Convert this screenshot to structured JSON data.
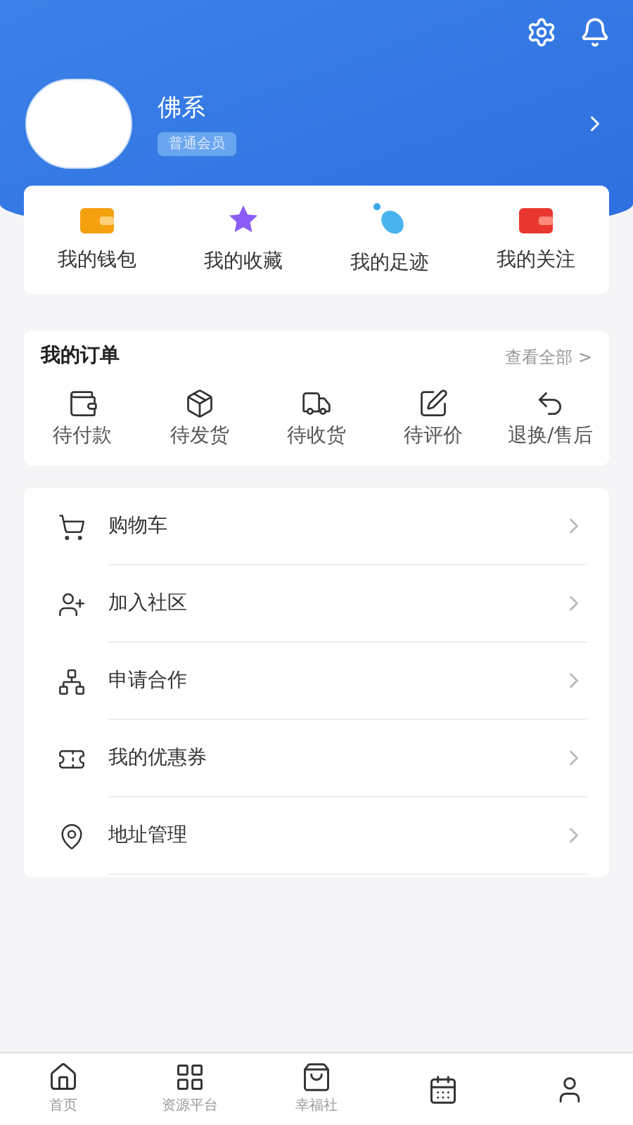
{
  "profile": {
    "name": "佛系",
    "badge": "普通会员"
  },
  "shortcuts": [
    {
      "kind": "wallet",
      "label": "我的钱包"
    },
    {
      "kind": "star",
      "label": "我的收藏"
    },
    {
      "kind": "foot",
      "label": "我的足迹"
    },
    {
      "kind": "follow",
      "label": "我的关注"
    }
  ],
  "orders": {
    "title": "我的订单",
    "view_all": "查看全部 >",
    "items": [
      {
        "kind": "pay",
        "label": "待付款"
      },
      {
        "kind": "ship",
        "label": "待发货"
      },
      {
        "kind": "receive",
        "label": "待收货"
      },
      {
        "kind": "review",
        "label": "待评价"
      },
      {
        "kind": "refund",
        "label": "退换/售后"
      }
    ]
  },
  "menu": [
    {
      "kind": "cart",
      "label": "购物车"
    },
    {
      "kind": "community",
      "label": "加入社区"
    },
    {
      "kind": "cooperate",
      "label": "申请合作"
    },
    {
      "kind": "coupon",
      "label": "我的优惠券"
    },
    {
      "kind": "address",
      "label": "地址管理"
    }
  ],
  "tabbar": [
    {
      "kind": "home",
      "label": "首页"
    },
    {
      "kind": "grid",
      "label": "资源平台"
    },
    {
      "kind": "bag",
      "label": "幸福社"
    },
    {
      "kind": "calendar"
    },
    {
      "kind": "user"
    }
  ]
}
